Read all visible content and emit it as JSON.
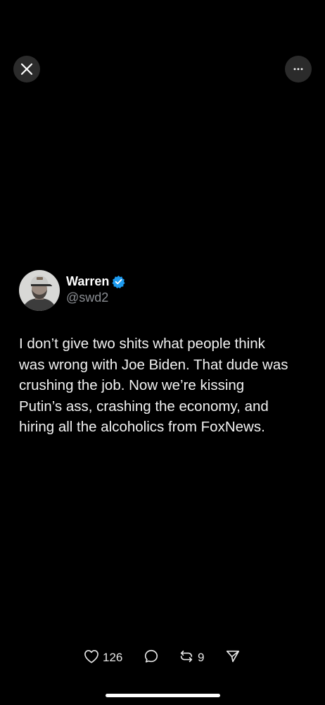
{
  "header": {
    "close_icon": "close-icon",
    "more_icon": "more-options-icon"
  },
  "tweet": {
    "author": {
      "display_name": "Warren",
      "handle": "@swd2",
      "verified": true,
      "verified_color": "#1d9bf0"
    },
    "text": "I don’t give two shits what people think\nwas wrong with Joe Biden. That dude was\ncrushing the job. Now we’re kissing\nPutin’s ass, crashing the economy, and\nhiring all the alcoholics from FoxNews."
  },
  "actions": {
    "likes": "126",
    "reposts": "9"
  },
  "colors": {
    "background": "#000000",
    "text": "#ffffff",
    "secondary_text": "#8b8e93",
    "button_bg": "#2b2b2b"
  }
}
